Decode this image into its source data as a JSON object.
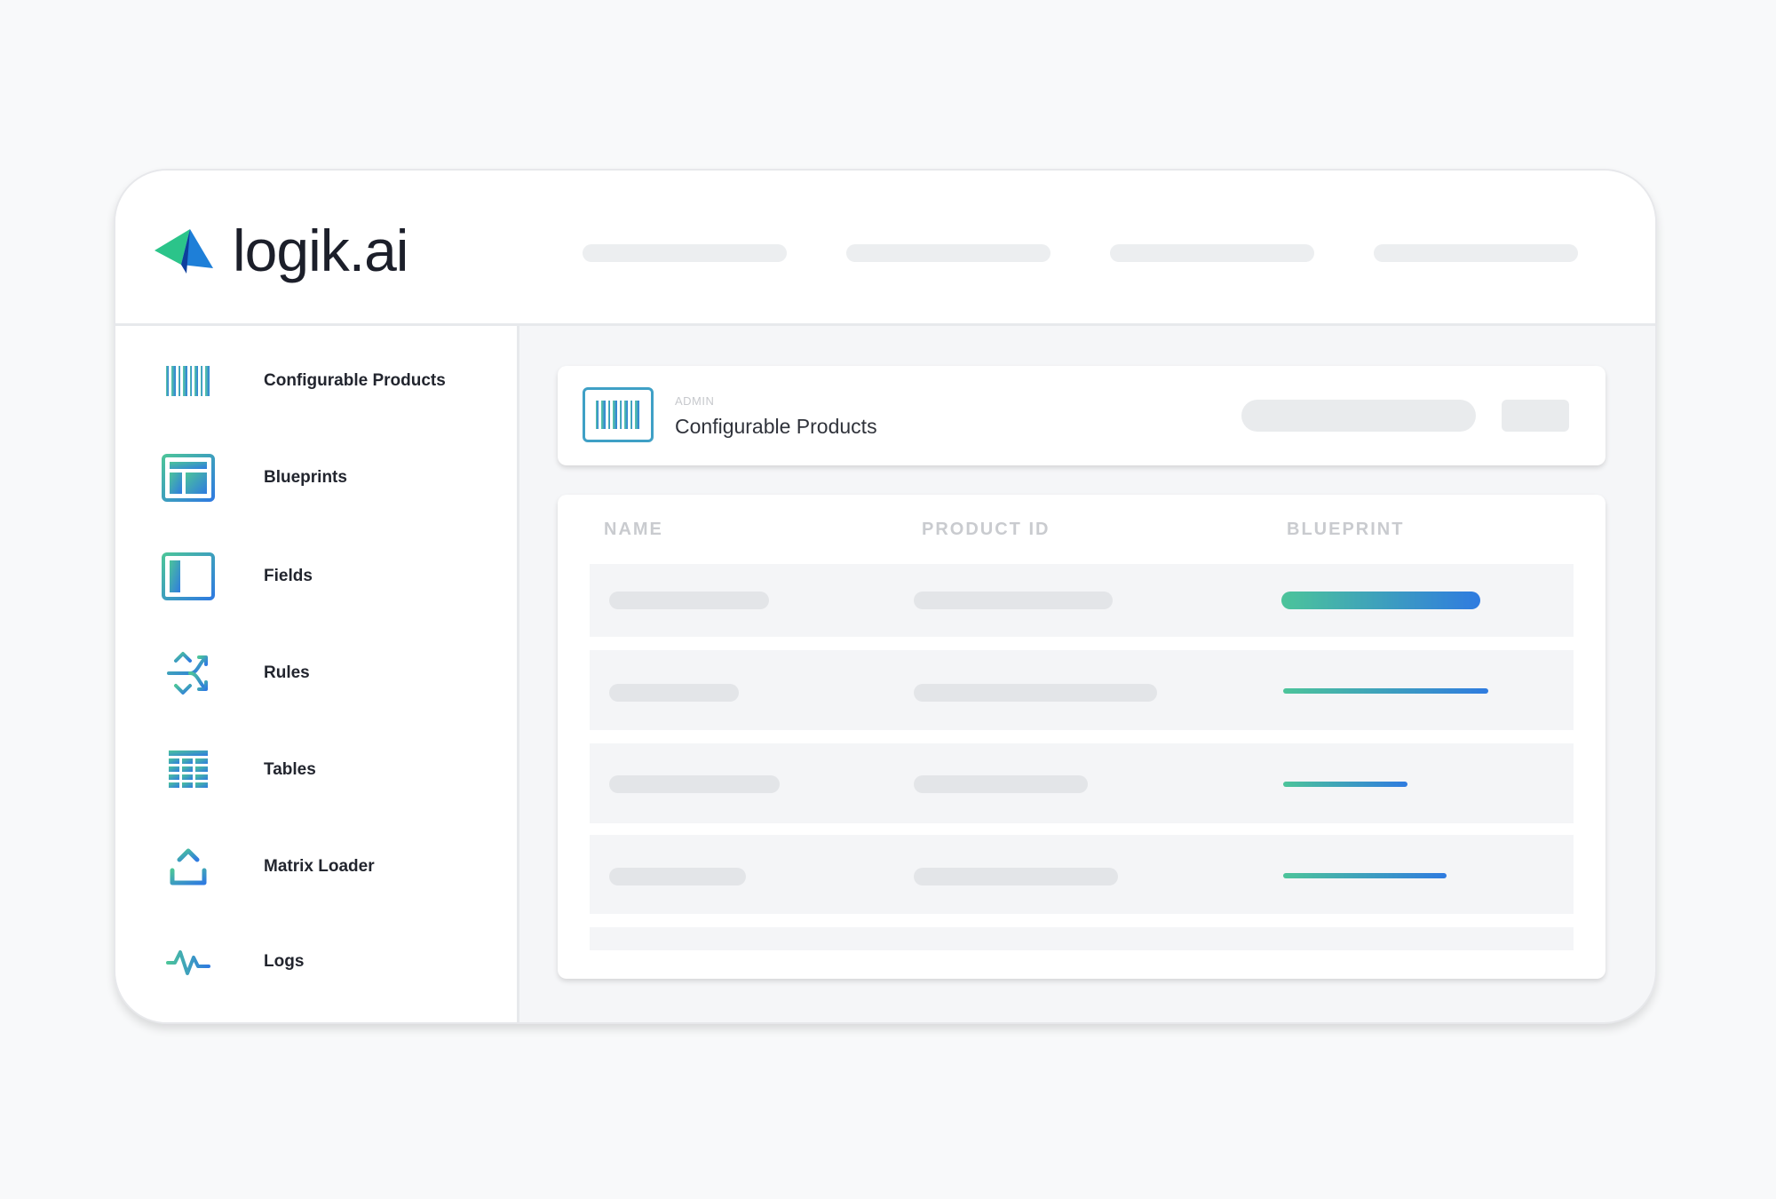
{
  "brand": {
    "name": "logik.ai",
    "logo_colors": [
      "#2bc48a",
      "#1e7fd8",
      "#0d3f9c"
    ]
  },
  "sidebar": {
    "items": [
      {
        "label": "Configurable Products",
        "icon": "barcode-icon"
      },
      {
        "label": "Blueprints",
        "icon": "blueprint-layout-icon"
      },
      {
        "label": "Fields",
        "icon": "field-panel-icon"
      },
      {
        "label": "Rules",
        "icon": "rules-split-arrows-icon"
      },
      {
        "label": "Tables",
        "icon": "table-grid-icon"
      },
      {
        "label": "Matrix Loader",
        "icon": "upload-icon"
      },
      {
        "label": "Logs",
        "icon": "pulse-icon"
      }
    ]
  },
  "page": {
    "breadcrumb": "ADMIN",
    "title": "Configurable Products"
  },
  "table": {
    "columns": [
      "NAME",
      "PRODUCT ID",
      "BLUEPRINT"
    ],
    "row_count": 4
  },
  "colors": {
    "accent_gradient_start": "#4cc49a",
    "accent_gradient_end": "#2f7be0",
    "placeholder": "#e3e5e8"
  }
}
